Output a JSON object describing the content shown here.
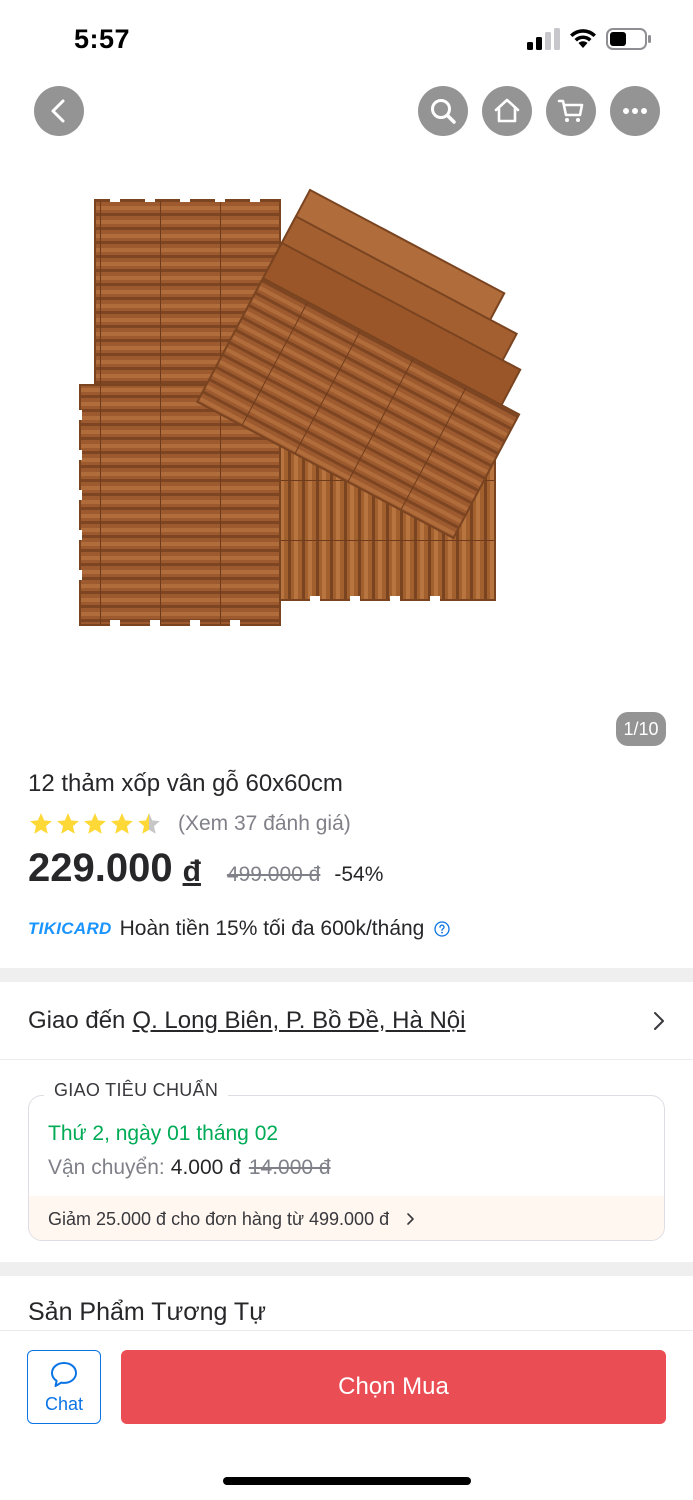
{
  "status_bar": {
    "time": "5:57"
  },
  "nav": {
    "back_icon": "chevron-left-icon",
    "search_icon": "search-icon",
    "home_icon": "home-icon",
    "cart_icon": "cart-icon",
    "more_icon": "more-dots-icon"
  },
  "gallery": {
    "counter": "1/10"
  },
  "product": {
    "title": "12 thảm xốp vân gỗ 60x60cm",
    "rating": 4.5,
    "review_link": "(Xem 37 đánh giá)",
    "price": "229.000",
    "currency": "đ",
    "old_price": "499.000 đ",
    "discount": "-54%"
  },
  "tikicard": {
    "logo": "TIKICARD",
    "text": "Hoàn tiền 15% tối đa 600k/tháng"
  },
  "delivery": {
    "prefix": "Giao đến",
    "address": "Q. Long Biên, P. Bồ Đề, Hà Nội"
  },
  "shipping": {
    "label": "GIAO TIÊU CHUẨN",
    "date": "Thứ 2, ngày 01 tháng 02",
    "fee_label": "Vận chuyển:",
    "fee_value": "4.000 đ",
    "fee_old": "14.000 đ",
    "promo": "Giảm 25.000 đ cho đơn hàng từ 499.000 đ"
  },
  "similar": {
    "title": "Sản Phẩm Tương Tự"
  },
  "bottom_bar": {
    "chat_label": "Chat",
    "buy_label": "Chọn Mua"
  },
  "colors": {
    "price_text": "#27272a",
    "green": "#00ab56",
    "buy_button": "#ea4d54",
    "link_blue": "#0b74e5",
    "star": "#fdd836"
  }
}
